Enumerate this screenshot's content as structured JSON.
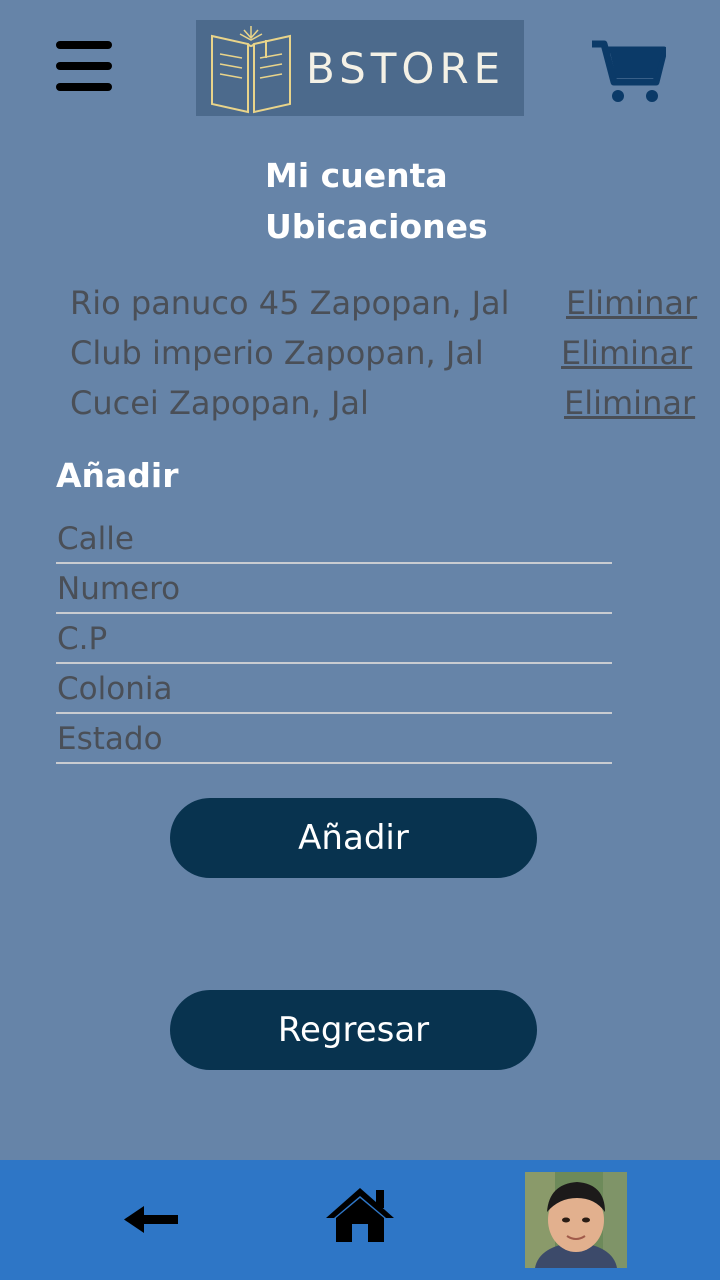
{
  "header": {
    "logo_text": "BSTORE",
    "menu_icon": "hamburger-menu-icon",
    "cart_icon": "shopping-cart-icon"
  },
  "page": {
    "title": "Mi cuenta",
    "subtitle": "Ubicaciones"
  },
  "addresses": [
    {
      "text": "Rio panuco 45 Zapopan, Jal",
      "action": "Eliminar"
    },
    {
      "text": "Club imperio Zapopan, Jal",
      "action": "Eliminar"
    },
    {
      "text": "Cucei Zapopan, Jal",
      "action": "Eliminar"
    }
  ],
  "form": {
    "heading": "Añadir",
    "fields": {
      "street": {
        "placeholder": "Calle",
        "value": ""
      },
      "number": {
        "placeholder": "Numero",
        "value": ""
      },
      "zip": {
        "placeholder": "C.P",
        "value": ""
      },
      "neighborhood": {
        "placeholder": "Colonia",
        "value": ""
      },
      "state": {
        "placeholder": "Estado",
        "value": ""
      }
    },
    "submit_label": "Añadir"
  },
  "back_button_label": "Regresar",
  "bottom_nav": {
    "back_icon": "left-arrow-icon",
    "home_icon": "home-icon",
    "avatar_icon": "user-avatar"
  },
  "colors": {
    "background": "#6684a8",
    "button": "#08334f",
    "bottom_bar": "#2e76c6",
    "cart": "#0b3a68",
    "muted_text": "#4a4f57"
  }
}
